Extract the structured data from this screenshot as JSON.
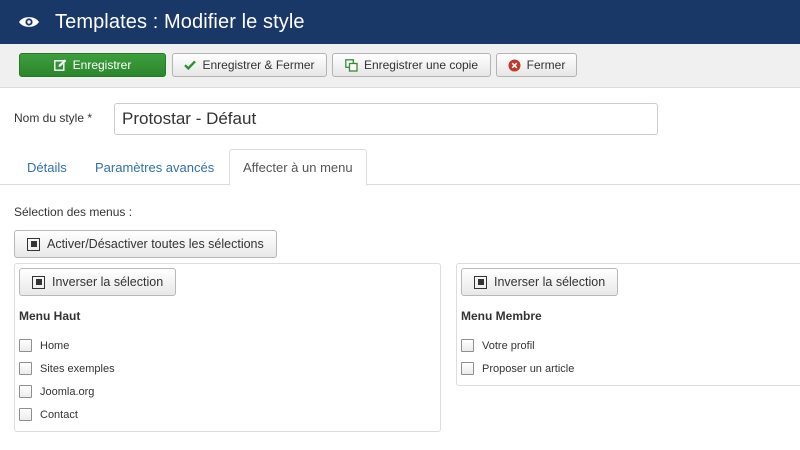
{
  "header": {
    "title": "Templates : Modifier le style",
    "icon": "eye-icon"
  },
  "toolbar": {
    "save": {
      "label": "Enregistrer",
      "icon": "edit-icon"
    },
    "save_close": {
      "label": "Enregistrer & Fermer",
      "icon": "check-icon"
    },
    "save_copy": {
      "label": "Enregistrer une copie",
      "icon": "copy-icon"
    },
    "close": {
      "label": "Fermer",
      "icon": "close-circle-icon"
    }
  },
  "style": {
    "label": "Nom du style *",
    "value": "Protostar - Défaut"
  },
  "tabs": [
    {
      "label": "Détails",
      "active": false
    },
    {
      "label": "Paramètres avancés",
      "active": false
    },
    {
      "label": "Affecter à un menu",
      "active": true
    }
  ],
  "assignment": {
    "label": "Sélection des menus :",
    "toggle_all": "Activer/Désactiver toutes les sélections",
    "menus": [
      {
        "invert": "Inverser la sélection",
        "title": "Menu Haut",
        "items": [
          "Home",
          "Sites exemples",
          "Joomla.org",
          "Contact"
        ]
      },
      {
        "invert": "Inverser la sélection",
        "title": "Menu Membre",
        "items": [
          "Votre profil",
          "Proposer un article"
        ]
      }
    ]
  },
  "colors": {
    "header_bg": "#1a3867",
    "primary": "#2f8f2f",
    "link": "#3071a9",
    "close_icon": "#c0392b"
  }
}
